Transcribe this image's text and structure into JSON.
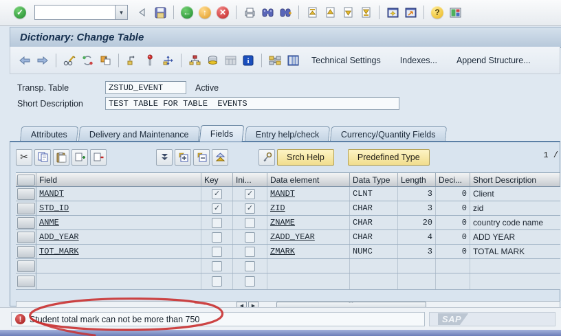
{
  "window": {
    "title": "Dictionary: Change Table"
  },
  "system_toolbar": {
    "command_field_value": "",
    "icons": [
      "enter-check",
      "enter-arrow",
      "save",
      "back",
      "exit",
      "cancel",
      "print",
      "find",
      "find-next",
      "first-page",
      "previous-page",
      "next-page",
      "last-page",
      "new-session",
      "create-shortcut",
      "help",
      "customize-layout"
    ]
  },
  "app_toolbar": {
    "icons": [
      "back-arrow",
      "forward-arrow",
      "display-change",
      "refresh",
      "copy",
      "parent-object",
      "activate-pin",
      "where-used",
      "hierarchy",
      "stack",
      "table-display",
      "information",
      "structure",
      "runtime-object"
    ],
    "buttons": {
      "technical_settings": "Technical Settings",
      "indexes": "Indexes...",
      "append_structure": "Append Structure..."
    }
  },
  "form": {
    "transp_table_label": "Transp. Table",
    "transp_table_value": "ZSTUD_EVENT",
    "status": "Active",
    "short_desc_label": "Short Description",
    "short_desc_value": "TEST TABLE FOR TABLE  EVENTS"
  },
  "tabs": [
    {
      "label": "Attributes",
      "active": false
    },
    {
      "label": "Delivery and Maintenance",
      "active": false
    },
    {
      "label": "Fields",
      "active": true
    },
    {
      "label": "Entry help/check",
      "active": false
    },
    {
      "label": "Currency/Quantity Fields",
      "active": false
    }
  ],
  "fields_toolbar": {
    "icons": [
      "cut",
      "copy",
      "paste",
      "insert-row",
      "delete-row",
      "choose-down",
      "expand",
      "collapse",
      "sort-up",
      "srch-help-key"
    ],
    "srch_help_label": "Srch Help",
    "predefined_type_label": "Predefined Type",
    "page_indicator": "1 /"
  },
  "table": {
    "columns": [
      "Field",
      "Key",
      "Ini...",
      "Data element",
      "Data Type",
      "Length",
      "Deci...",
      "Short Description"
    ],
    "rows": [
      {
        "field": "MANDT",
        "key": true,
        "ini": true,
        "data_element": "MANDT",
        "data_type": "CLNT",
        "length": "3",
        "decimals": "0",
        "short_description": "Client"
      },
      {
        "field": "STD_ID",
        "key": true,
        "ini": true,
        "data_element": "ZID",
        "data_type": "CHAR",
        "length": "3",
        "decimals": "0",
        "short_description": "zid"
      },
      {
        "field": "ANME",
        "key": false,
        "ini": false,
        "data_element": "ZNAME",
        "data_type": "CHAR",
        "length": "20",
        "decimals": "0",
        "short_description": "country code name"
      },
      {
        "field": "ADD_YEAR",
        "key": false,
        "ini": false,
        "data_element": "ZADD_YEAR",
        "data_type": "CHAR",
        "length": "4",
        "decimals": "0",
        "short_description": "ADD YEAR"
      },
      {
        "field": "TOT_MARK",
        "key": false,
        "ini": false,
        "data_element": "ZMARK",
        "data_type": "NUMC",
        "length": "3",
        "decimals": "0",
        "short_description": "TOTAL MARK"
      },
      {
        "field": "",
        "key": false,
        "ini": false,
        "data_element": "",
        "data_type": "",
        "length": "",
        "decimals": "",
        "short_description": ""
      },
      {
        "field": "",
        "key": false,
        "ini": false,
        "data_element": "",
        "data_type": "",
        "length": "",
        "decimals": "",
        "short_description": ""
      }
    ]
  },
  "status_bar": {
    "error_icon": "error-exclamation",
    "message": "Student total mark can not be more than 750",
    "logo": "SAP"
  },
  "colors": {
    "title_bar": "#c4d4e4",
    "panel_bg": "#d9e4ef",
    "yellow_button": "#f5e49a",
    "error_red": "#b02020",
    "annotation_red": "#c93030",
    "bottom_strip": "#7e8fc2"
  }
}
